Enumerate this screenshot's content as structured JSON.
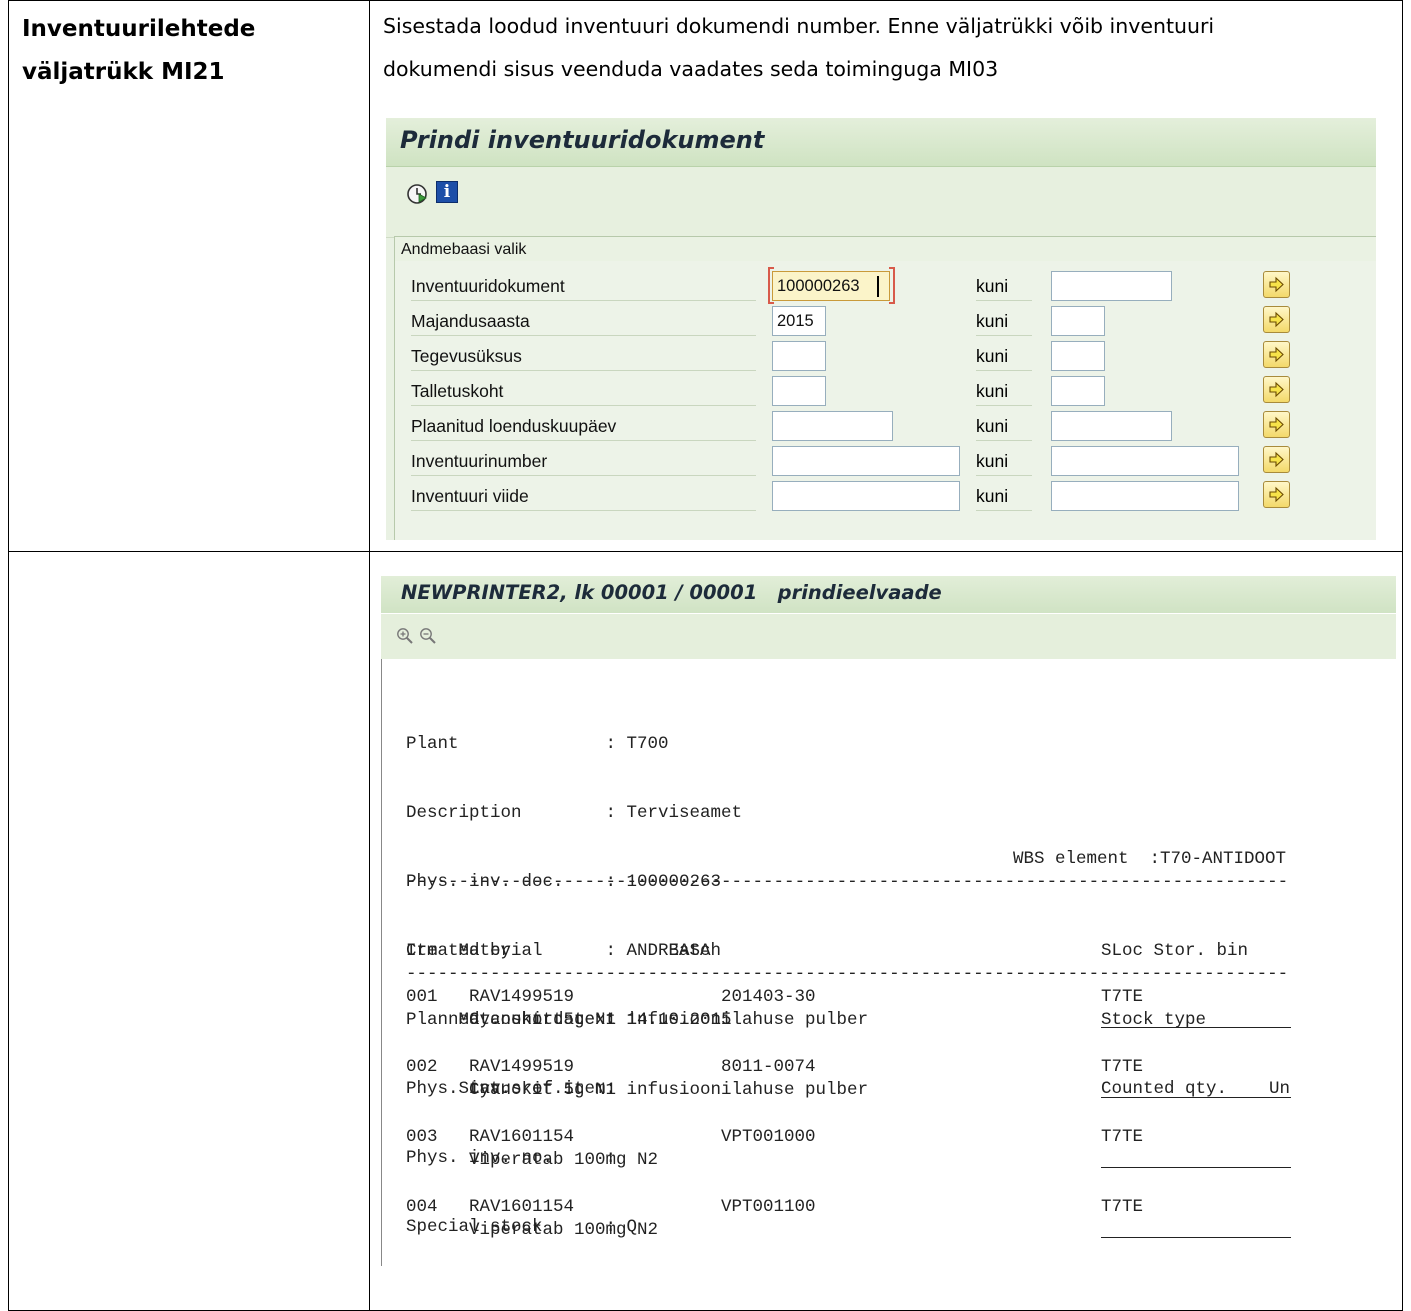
{
  "doc": {
    "step_title_line1": "Inventuurilehtede",
    "step_title_line2": "väljatrükk MI21",
    "instruction_line1": "Sisestada loodud inventuuri dokumendi number. Enne väljatrükki võib inventuuri",
    "instruction_line2": "dokumendi sisus veenduda vaadates seda toiminguga MI03"
  },
  "screen1": {
    "title": "Prindi inventuuridokument",
    "toolbar": {
      "execute_icon": "clock-execute-icon",
      "info_icon": "info-icon",
      "info_glyph": "i"
    },
    "group_title": "Andmebaasi valik",
    "kuni_label": "kuni",
    "fields": [
      {
        "label": "Inventuuridokument",
        "from": "100000263",
        "to": ""
      },
      {
        "label": "Majandusaasta",
        "from": "2015",
        "to": ""
      },
      {
        "label": "Tegevusüksus",
        "from": "",
        "to": ""
      },
      {
        "label": "Talletuskoht",
        "from": "",
        "to": ""
      },
      {
        "label": "Plaanitud loenduskuupäev",
        "from": "",
        "to": ""
      },
      {
        "label": "Inventuurinumber",
        "from": "",
        "to": ""
      },
      {
        "label": "Inventuuri viide",
        "from": "",
        "to": ""
      }
    ],
    "arrow_button_icon": "multiple-selection-arrow-icon",
    "accent_color": "#d6e7ca"
  },
  "screen2": {
    "title": "NEWPRINTER2, lk 00001 / 00001   prindieelvaade",
    "toolbar": {
      "zoom_in_icon": "zoom-in-icon",
      "zoom_out_icon": "zoom-out-icon"
    },
    "header_lines": [
      "Plant              : T700",
      "Description        : Terviseamet",
      "Phys. inv. doc.    : 100000263",
      "Created by         : ANDREASA",
      "Planned count date : 14.10.2015",
      "Phys. inv. ref.    :",
      "Phys. inv. no.     :",
      "Special stock      : Q"
    ],
    "wbs_text": "WBS element  :T70-ANTIDOOT",
    "separator": "------------------------------------------------------------------------------------",
    "column_headers_left": [
      "Itm  Material            Batch",
      "     Mat. short text",
      "     Status of item"
    ],
    "column_headers_right": [
      "SLoc Stor. bin",
      "Stock type",
      "Counted qty.    Un"
    ],
    "items": [
      {
        "itm": "001",
        "material": "RAV1499519",
        "batch": "201403-30",
        "sloc": "T7TE",
        "text": "Cyanokit 5g N1 infusioonilahuse pulber"
      },
      {
        "itm": "002",
        "material": "RAV1499519",
        "batch": "8011-0074",
        "sloc": "T7TE",
        "text": "Cyanokit 5g N1 infusioonilahuse pulber"
      },
      {
        "itm": "003",
        "material": "RAV1601154",
        "batch": "VPT001000",
        "sloc": "T7TE",
        "text": "Viperatab 100mg N2"
      },
      {
        "itm": "004",
        "material": "RAV1601154",
        "batch": "VPT001100",
        "sloc": "T7TE",
        "text": "Viperatab 100mg N2"
      }
    ]
  }
}
